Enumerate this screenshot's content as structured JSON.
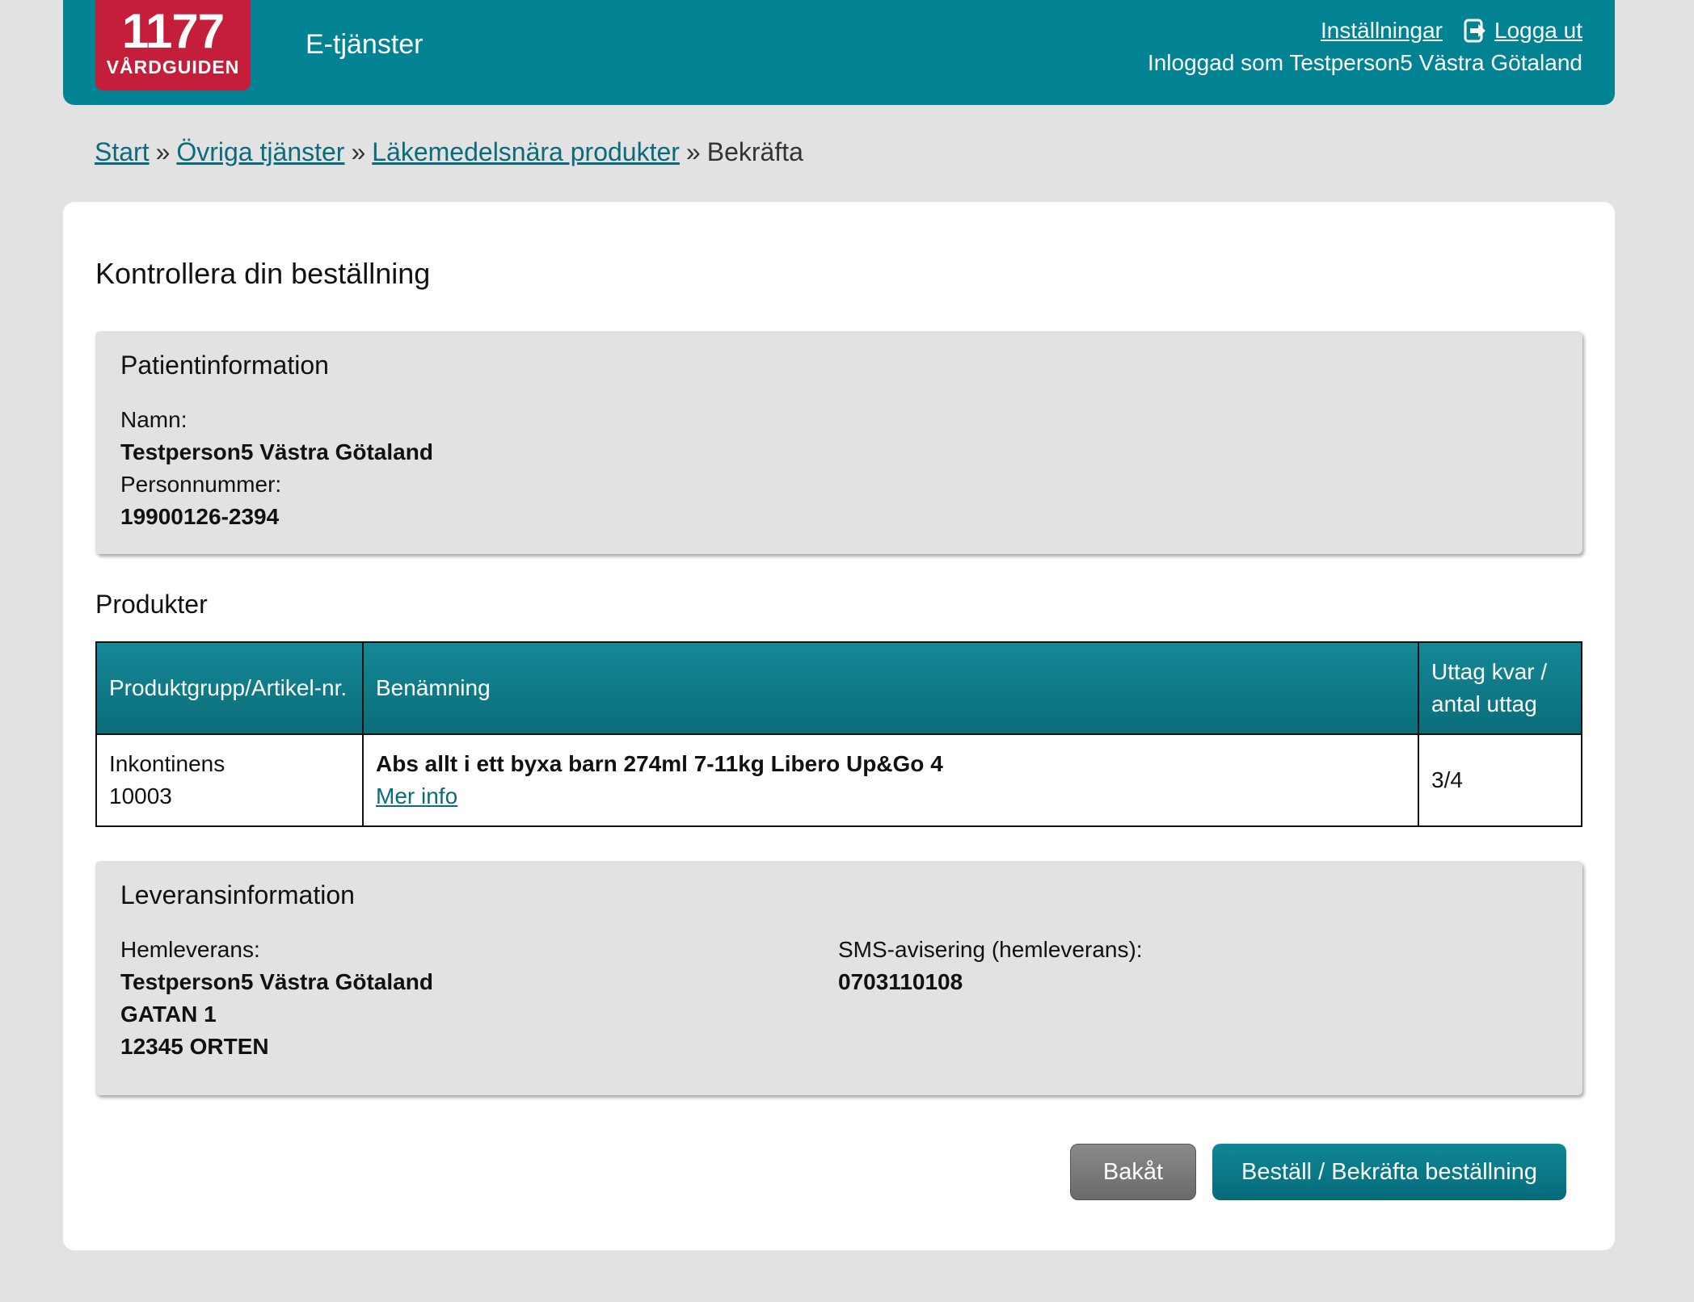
{
  "header": {
    "logo_number": "1177",
    "logo_text": "VÅRDGUIDEN",
    "app_title": "E-tjänster",
    "settings_link": "Inställningar",
    "logout_link": "Logga ut",
    "logged_in_as": "Inloggad som Testperson5 Västra Götaland"
  },
  "breadcrumb": {
    "items": [
      "Start",
      "Övriga tjänster",
      "Läkemedelsnära produkter"
    ],
    "current": "Bekräfta",
    "separator": "»"
  },
  "main": {
    "title": "Kontrollera din beställning",
    "patient": {
      "heading": "Patientinformation",
      "name_label": "Namn:",
      "name_value": "Testperson5 Västra Götaland",
      "pnr_label": "Personnummer:",
      "pnr_value": "19900126-2394"
    },
    "products": {
      "heading": "Produkter",
      "columns": [
        "Produktgrupp/Artikel-nr.",
        "Benämning",
        "Uttag kvar / antal uttag"
      ],
      "rows": [
        {
          "group": "Inkontinens",
          "article_no": "10003",
          "name": "Abs allt i ett byxa barn 274ml 7-11kg Libero Up&Go 4",
          "more_info": "Mer info",
          "withdrawals": "3/4"
        }
      ]
    },
    "delivery": {
      "heading": "Leveransinformation",
      "home_label": "Hemleverans:",
      "home_name": "Testperson5 Västra Götaland",
      "home_street": "GATAN 1",
      "home_city": "12345 ORTEN",
      "sms_label": "SMS-avisering (hemleverans):",
      "sms_value": "0703110108"
    },
    "buttons": {
      "back": "Bakåt",
      "confirm": "Beställ / Bekräfta beställning"
    }
  },
  "colors": {
    "brand_teal": "#028393",
    "logo_red": "#c41e3a",
    "link": "#0a6c7a"
  }
}
